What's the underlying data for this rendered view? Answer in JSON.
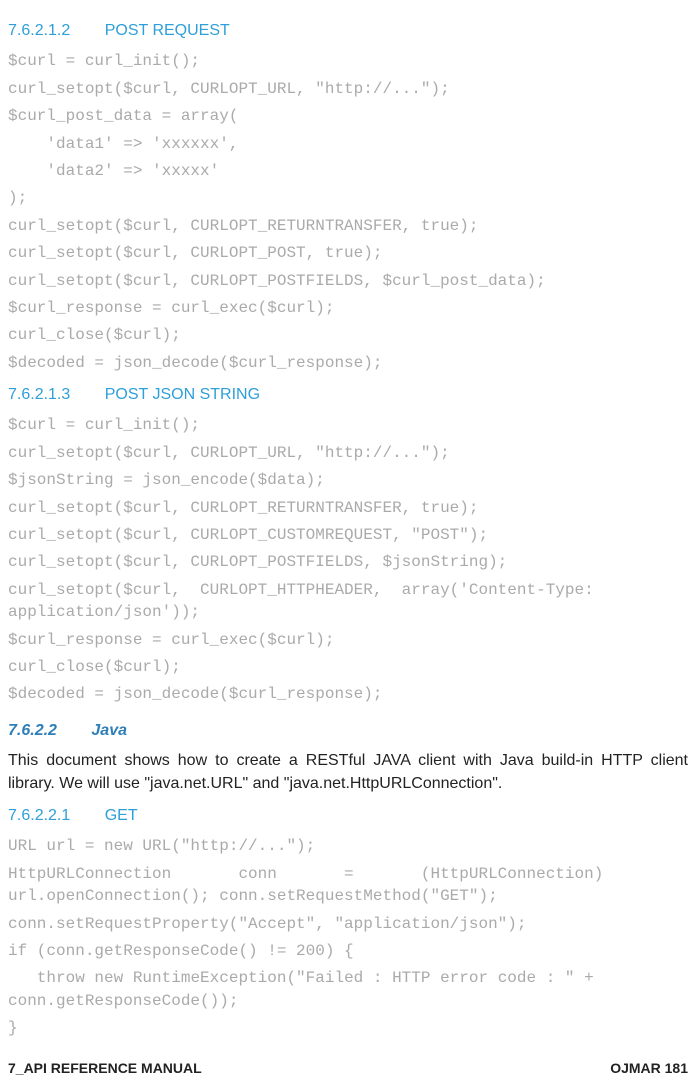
{
  "section_post": {
    "number": "7.6.2.1.2",
    "title": "POST REQUEST",
    "code": [
      "$curl = curl_init();",
      "curl_setopt($curl, CURLOPT_URL, \"http://...\");",
      "$curl_post_data = array(",
      "    'data1' => 'xxxxxx',",
      "    'data2' => 'xxxxx'",
      ");",
      "curl_setopt($curl, CURLOPT_RETURNTRANSFER, true);",
      "curl_setopt($curl, CURLOPT_POST, true);",
      "curl_setopt($curl, CURLOPT_POSTFIELDS, $curl_post_data);",
      "$curl_response = curl_exec($curl);",
      "curl_close($curl);",
      "$decoded = json_decode($curl_response);"
    ]
  },
  "section_json": {
    "number": "7.6.2.1.3",
    "title": "POST JSON STRING",
    "code": [
      "$curl = curl_init();",
      "curl_setopt($curl, CURLOPT_URL, \"http://...\");",
      "$jsonString = json_encode($data);",
      "curl_setopt($curl, CURLOPT_RETURNTRANSFER, true);",
      "curl_setopt($curl, CURLOPT_CUSTOMREQUEST, \"POST\");",
      "curl_setopt($curl, CURLOPT_POSTFIELDS, $jsonString);",
      "curl_setopt($curl,  CURLOPT_HTTPHEADER,  array('Content-Type: application/json'));",
      "$curl_response = curl_exec($curl);",
      "curl_close($curl);",
      "$decoded = json_decode($curl_response);"
    ]
  },
  "section_java": {
    "number": "7.6.2.2",
    "title": "Java",
    "body": "This document shows how to create a RESTful JAVA client with Java build-in HTTP client library. We will use \"java.net.URL\" and \"java.net.HttpURLConnection\"."
  },
  "section_get": {
    "number": "7.6.2.2.1",
    "title": "GET",
    "code": [
      "URL url = new URL(\"http://...\");",
      "HttpURLConnection       conn       =       (HttpURLConnection) url.openConnection(); conn.setRequestMethod(\"GET\");",
      "conn.setRequestProperty(\"Accept\", \"application/json\");",
      "if (conn.getResponseCode() != 200) {",
      "   throw new RuntimeException(\"Failed : HTTP error code : \" + conn.getResponseCode());",
      "}"
    ]
  },
  "footer": {
    "left": "7_API REFERENCE MANUAL",
    "right": "OJMAR 181"
  }
}
